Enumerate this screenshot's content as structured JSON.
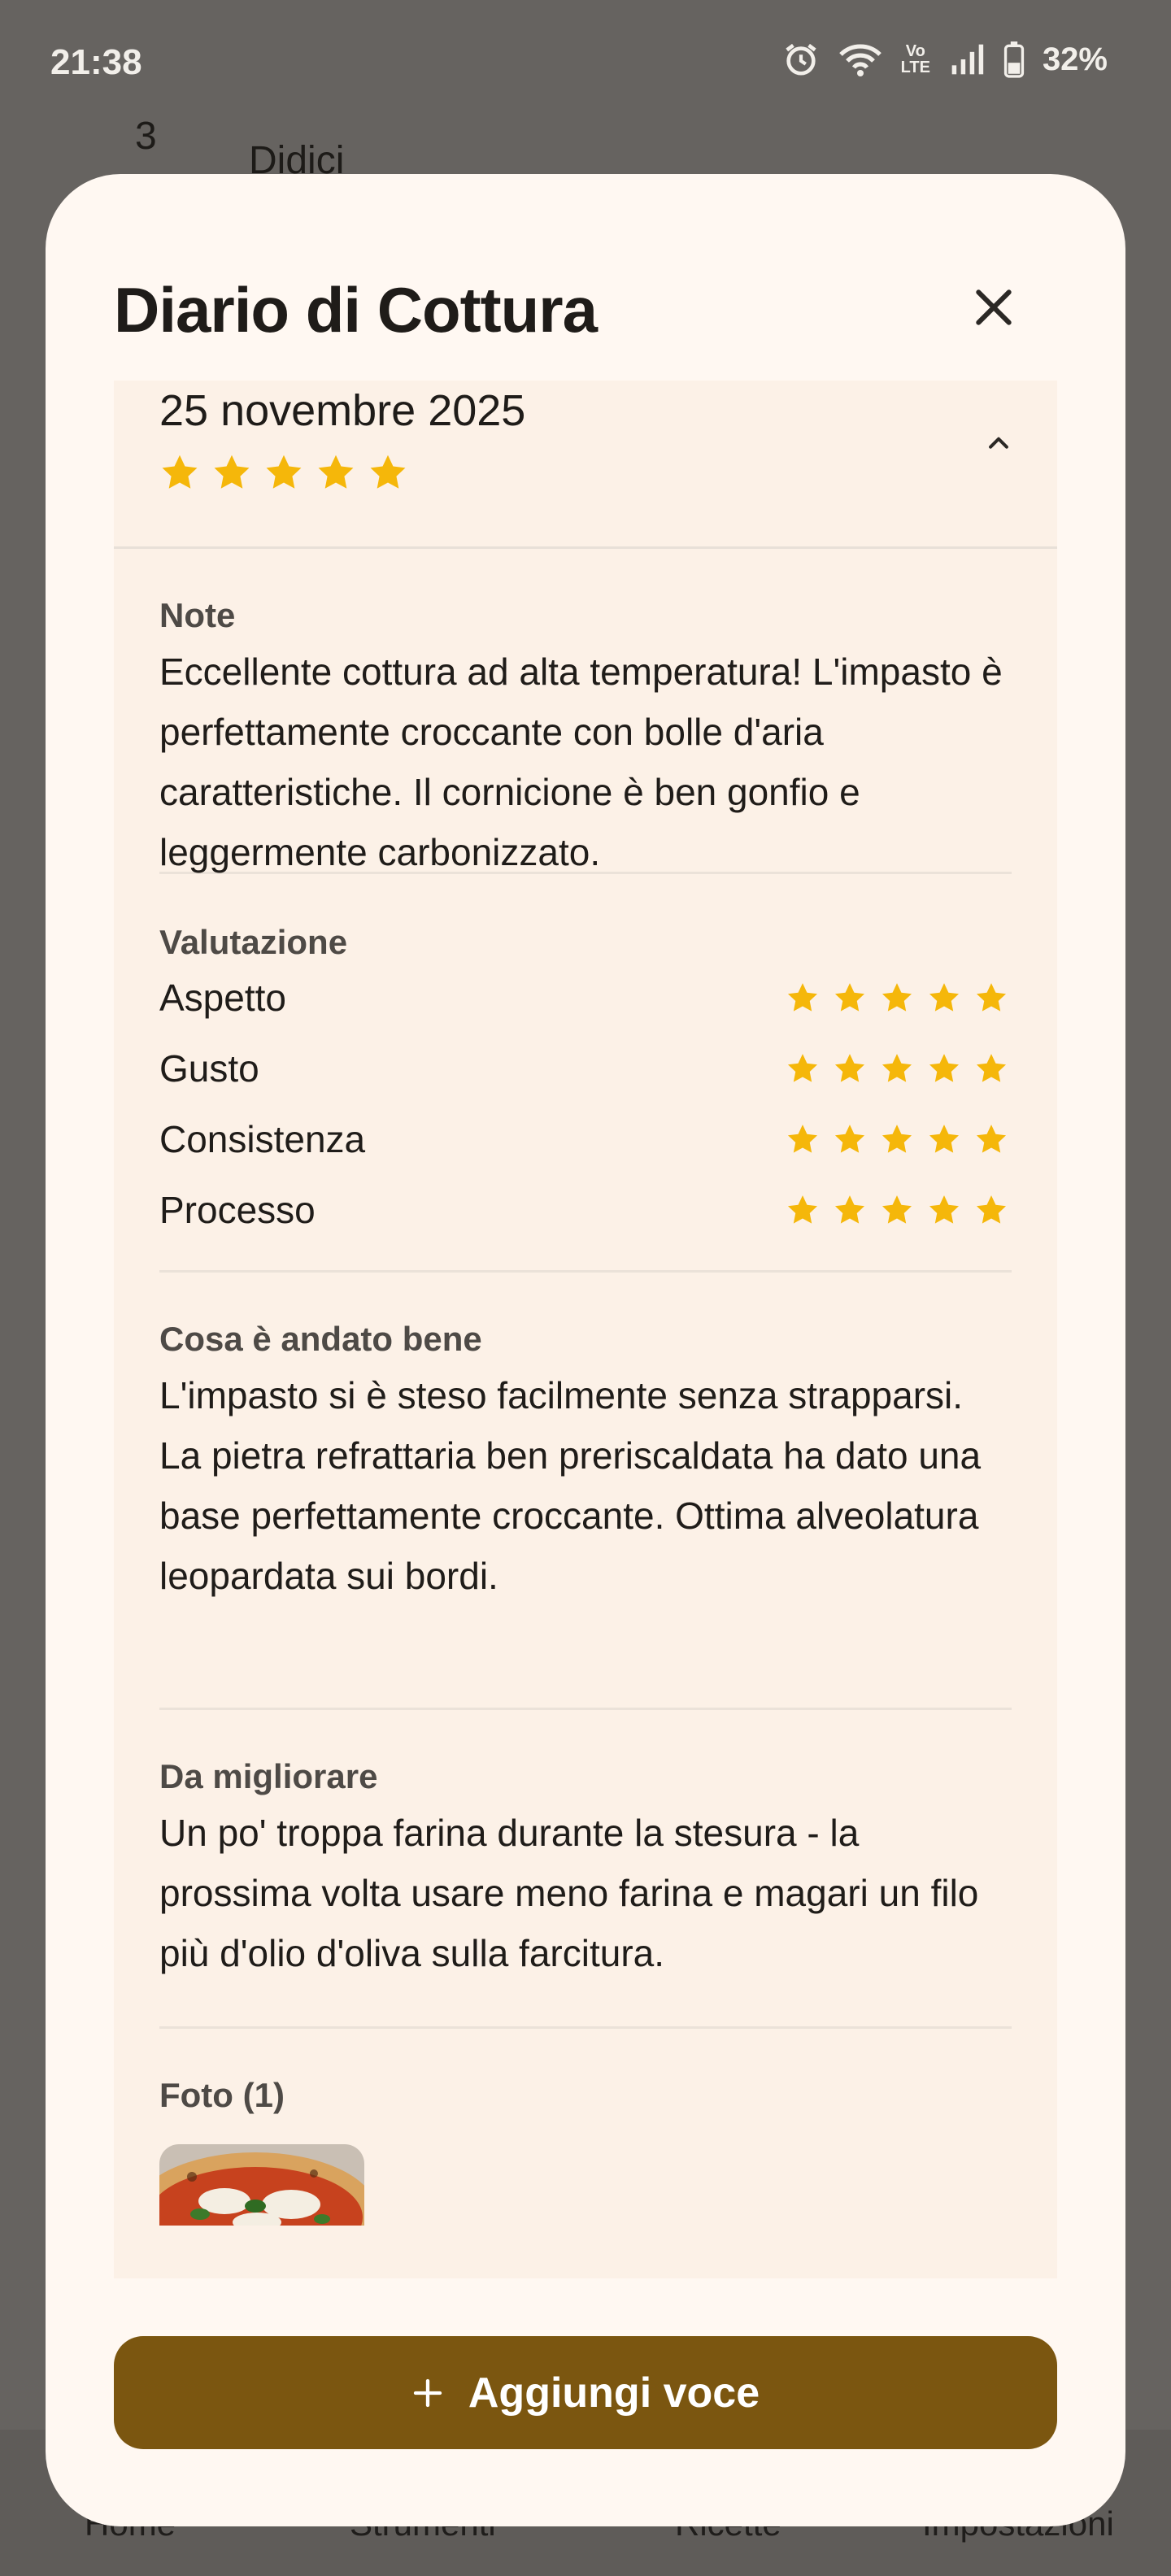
{
  "status_bar": {
    "time": "21:38",
    "battery": "32%",
    "network_type": "Vo\nLTE",
    "icons": [
      "alarm-icon",
      "wifi-icon",
      "volte-icon",
      "signal-icon",
      "battery-icon"
    ]
  },
  "background": {
    "list_number": "3",
    "list_title": "Didici",
    "nav": [
      "Home",
      "Strumenti",
      "Ricette",
      "Impostazioni"
    ]
  },
  "sheet": {
    "title": "Diario di Cottura",
    "entry": {
      "date": "25 novembre 2025",
      "overall_rating": 5,
      "note": {
        "label": "Note",
        "text": "Eccellente cottura ad alta temperatura! L'impasto è perfettamente croccante con bolle d'aria caratteristiche. Il cornicione è ben gonfio e leggermente carbonizzato."
      },
      "rating": {
        "label": "Valutazione",
        "items": [
          {
            "label": "Aspetto",
            "stars": 5
          },
          {
            "label": "Gusto",
            "stars": 5
          },
          {
            "label": "Consistenza",
            "stars": 5
          },
          {
            "label": "Processo",
            "stars": 5
          }
        ]
      },
      "good": {
        "label": "Cosa è andato bene",
        "text": "L'impasto si è steso facilmente senza strapparsi. La pietra refrattaria ben preriscaldata ha dato una base perfettamente croccante. Ottima alveolatura leopardata sui bordi."
      },
      "improve": {
        "label": "Da migliorare",
        "text": "Un po' troppa farina durante la stesura - la prossima volta usare meno farina e magari un filo più d'olio d'oliva sulla farcitura."
      },
      "photos": {
        "label": "Foto (1)"
      }
    },
    "add_button": {
      "icon": "plus-icon",
      "label": "Aggiungi voce"
    }
  },
  "colors": {
    "star": "#F5B70A",
    "button": "#7B5610",
    "sheet_bg": "#FFF8F2",
    "entry_bg": "#FCF1E7"
  }
}
